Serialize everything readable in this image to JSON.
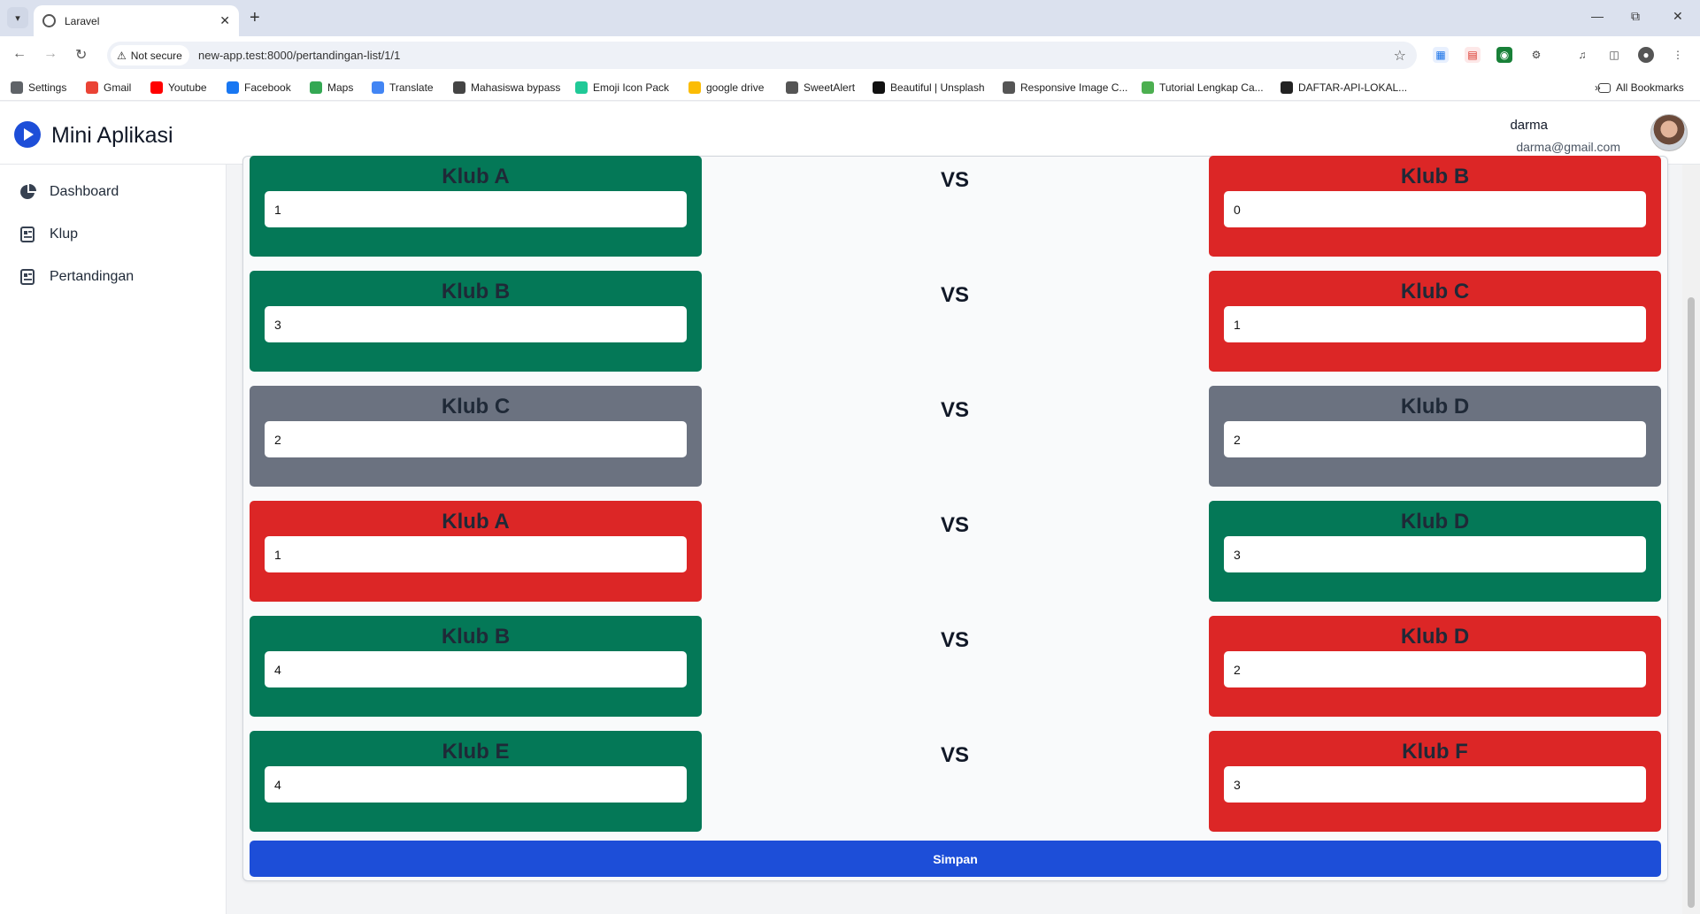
{
  "browser": {
    "tab_title": "Laravel",
    "security_label": "Not secure",
    "url": "new-app.test:8000/pertandingan-list/1/1",
    "bookmarks": [
      {
        "label": "Settings",
        "icon": "gear-icon",
        "color": "#5f6368"
      },
      {
        "label": "Gmail",
        "icon": "gmail-icon",
        "color": "#ea4335"
      },
      {
        "label": "Youtube",
        "icon": "youtube-icon",
        "color": "#ff0000"
      },
      {
        "label": "Facebook",
        "icon": "facebook-icon",
        "color": "#1877f2"
      },
      {
        "label": "Maps",
        "icon": "maps-icon",
        "color": "#34a853"
      },
      {
        "label": "Translate",
        "icon": "translate-icon",
        "color": "#4285f4"
      },
      {
        "label": "Mahasiswa bypass",
        "icon": "link-icon",
        "color": "#444444"
      },
      {
        "label": "Emoji Icon Pack",
        "icon": "emoji-icon",
        "color": "#20c997"
      },
      {
        "label": "google drive",
        "icon": "drive-icon",
        "color": "#fbbc04"
      },
      {
        "label": "SweetAlert",
        "icon": "sweetalert-icon",
        "color": "#555555"
      },
      {
        "label": "Beautiful | Unsplash",
        "icon": "unsplash-icon",
        "color": "#111111"
      },
      {
        "label": "Responsive Image C...",
        "icon": "image-icon",
        "color": "#555555"
      },
      {
        "label": "Tutorial Lengkap Ca...",
        "icon": "tutorial-icon",
        "color": "#4caf50"
      },
      {
        "label": "DAFTAR-API-LOKAL...",
        "icon": "api-icon",
        "color": "#222222"
      }
    ],
    "all_bookmarks": "All Bookmarks"
  },
  "app": {
    "title": "Mini Aplikasi",
    "user_name": "darma",
    "user_email": "darma@gmail.com"
  },
  "sidebar": {
    "items": [
      {
        "label": "Dashboard",
        "icon": "pie-chart-icon"
      },
      {
        "label": "Klup",
        "icon": "document-icon"
      },
      {
        "label": "Pertandingan",
        "icon": "document-icon"
      }
    ]
  },
  "vs_label": "VS",
  "matches": [
    {
      "home": {
        "name": "Klub A",
        "score": "1",
        "result": "win"
      },
      "away": {
        "name": "Klub B",
        "score": "0",
        "result": "lose"
      }
    },
    {
      "home": {
        "name": "Klub B",
        "score": "3",
        "result": "win"
      },
      "away": {
        "name": "Klub C",
        "score": "1",
        "result": "lose"
      }
    },
    {
      "home": {
        "name": "Klub C",
        "score": "2",
        "result": "draw"
      },
      "away": {
        "name": "Klub D",
        "score": "2",
        "result": "draw"
      }
    },
    {
      "home": {
        "name": "Klub A",
        "score": "1",
        "result": "lose"
      },
      "away": {
        "name": "Klub D",
        "score": "3",
        "result": "win"
      }
    },
    {
      "home": {
        "name": "Klub B",
        "score": "4",
        "result": "win"
      },
      "away": {
        "name": "Klub D",
        "score": "2",
        "result": "lose"
      }
    },
    {
      "home": {
        "name": "Klub E",
        "score": "4",
        "result": "win"
      },
      "away": {
        "name": "Klub F",
        "score": "3",
        "result": "lose"
      }
    }
  ],
  "result_colors": {
    "win": "#047857",
    "lose": "#dc2626",
    "draw": "#6b7280"
  },
  "save_label": "Simpan"
}
